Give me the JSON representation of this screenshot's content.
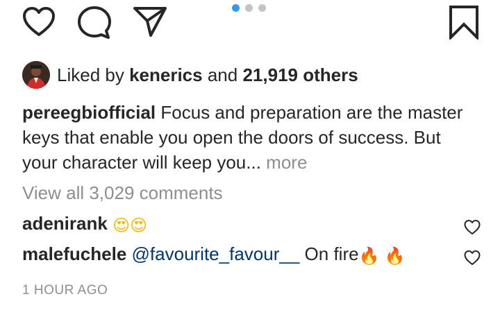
{
  "actions": {
    "icons": [
      "heart-outline-icon",
      "comment-bubble-icon",
      "share-paper-plane-icon",
      "bookmark-outline-icon"
    ],
    "carousel_dots": 3,
    "carousel_active_index": 0,
    "accent_color": "#3897f0"
  },
  "likes": {
    "prefix": "Liked by",
    "username": "kenerics",
    "connector": "and",
    "others": "21,919 others"
  },
  "caption": {
    "username": "pereegbiofficial",
    "text": "Focus and preparation are the master keys that enable you open the doors of success. But your character will keep you...",
    "more_label": "more"
  },
  "view_comments": "View all 3,029 comments",
  "comments": [
    {
      "username": "adenirank",
      "emojis": [
        "😍",
        "😍"
      ]
    },
    {
      "username": "malefuchele",
      "mention": "@favourite_favour__",
      "text": "On fire",
      "emojis": [
        "🔥",
        "🔥"
      ]
    }
  ],
  "timestamp": "1 HOUR AGO",
  "colors": {
    "text": "#262626",
    "muted": "#8e8e8e",
    "mention": "#003569"
  }
}
